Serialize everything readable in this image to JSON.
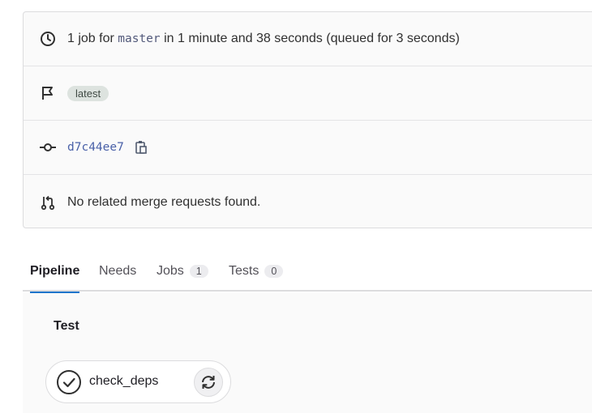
{
  "info": {
    "duration": {
      "prefix": "1 job for",
      "branch": "master",
      "suffix": "in 1 minute and 38 seconds (queued for 3 seconds)",
      "icon": "clock-icon"
    },
    "tag": {
      "label": "latest",
      "icon": "flag-icon"
    },
    "commit": {
      "sha": "d7c44ee7",
      "icon": "commit-icon",
      "copy_icon": "copy-icon"
    },
    "merge_requests": {
      "text": "No related merge requests found.",
      "icon": "merge-request-icon"
    }
  },
  "tabs": [
    {
      "label": "Pipeline",
      "active": true
    },
    {
      "label": "Needs"
    },
    {
      "label": "Jobs",
      "count": "1"
    },
    {
      "label": "Tests",
      "count": "0"
    }
  ],
  "pipeline": {
    "stage": "Test",
    "job": {
      "name": "check_deps",
      "status_icon": "success-check-icon",
      "action_icon": "retry-icon"
    }
  }
}
